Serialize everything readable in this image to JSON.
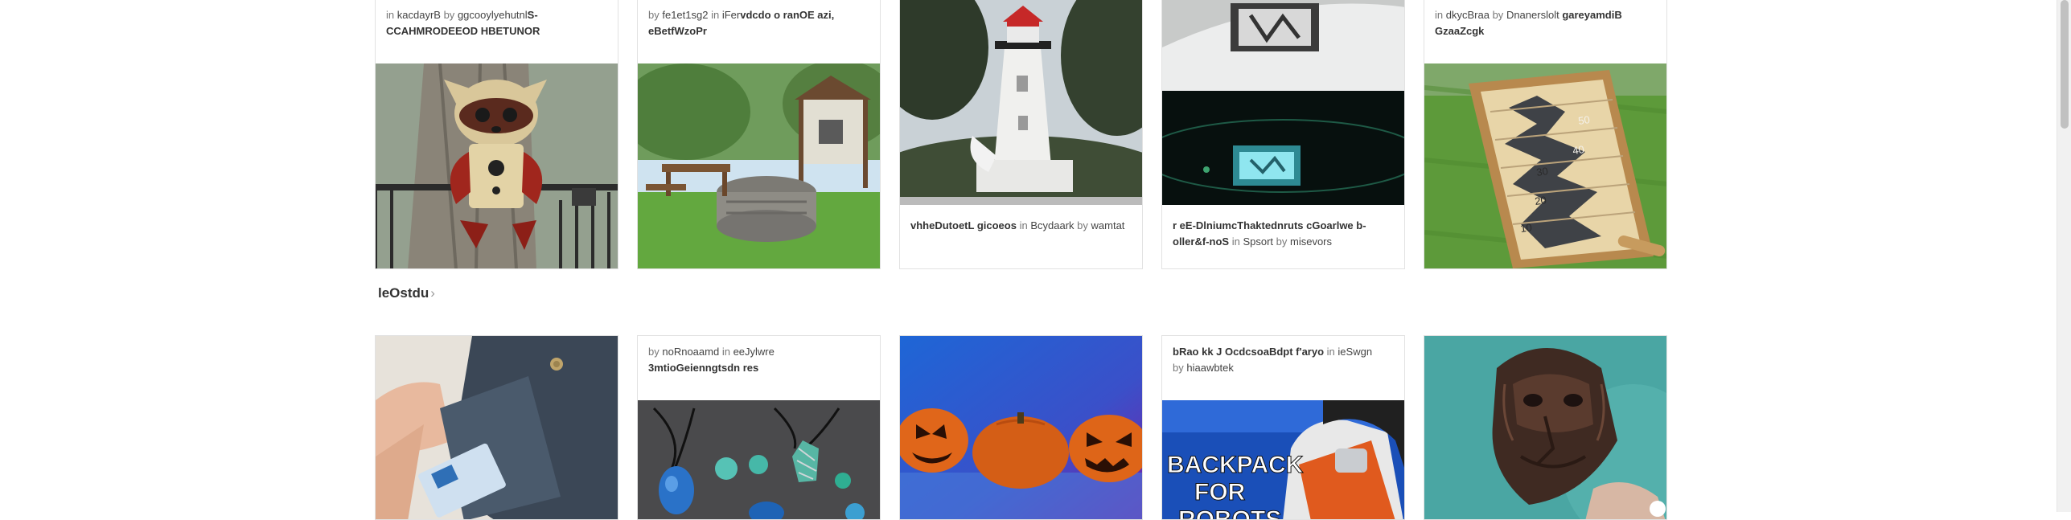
{
  "row1": [
    {
      "prefix": "in",
      "category": "kacdayrB",
      "by": "by",
      "author": "ggcooylyehutnl",
      "title": "S-CCAHMRODEEOD HBETUNOR"
    },
    {
      "prefix": "by",
      "author": "fe1et1sg2",
      "in": "in",
      "category": "iFer",
      "title": "vdcdo o ranOE azi, eBetfWzoPr"
    },
    {
      "title": "vhheDutoetL gicoeos",
      "in": "in",
      "category": "Bcydaark",
      "by": "by",
      "author": "wamtat"
    },
    {
      "title": "r eE-DlniumcThaktednruts cGoarlwe b-oller&f-noS",
      "in": "in",
      "category": "Spsort",
      "by": "by",
      "author": "misevors"
    },
    {
      "prefix": "in",
      "category": "dkycBraa",
      "by": "by",
      "author": "Dnanerslolt",
      "title": "gareyamdiB GzaaZcgk"
    }
  ],
  "section": {
    "title": "leOstdu",
    "chevron": "›"
  },
  "row2": [
    {},
    {
      "prefix": "by",
      "author": "noRnoaamd",
      "in": "in",
      "category": "eeJylwre",
      "title": "3mtioGeienngtsdn res"
    },
    {},
    {
      "title": "bRao kk J OcdcsoaBdpt f'aryo",
      "in": "in",
      "category": "ieSwgn",
      "by": "by",
      "author": "hiaawbtek"
    },
    {}
  ],
  "images": {
    "backpack_text": [
      "BACKPACK",
      "FOR",
      "ROBOTS"
    ],
    "board_marks": [
      "50",
      "40",
      "30",
      "20",
      "10"
    ]
  }
}
